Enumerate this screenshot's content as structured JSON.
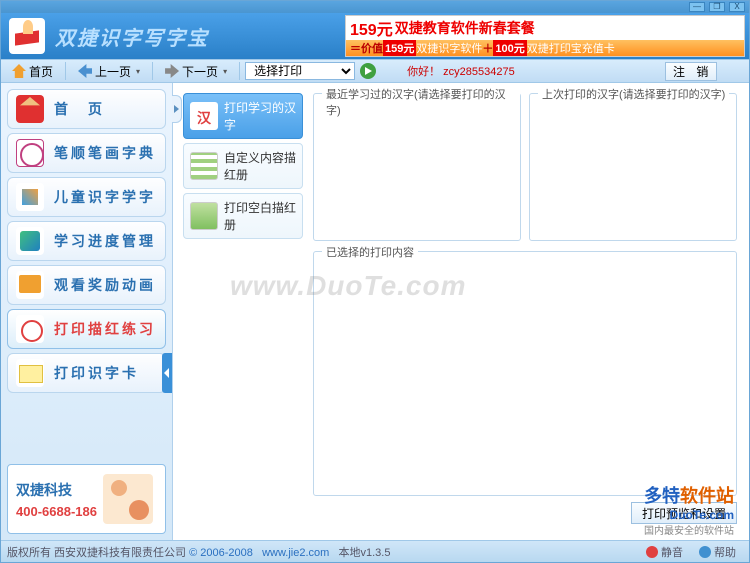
{
  "window": {
    "min": "—",
    "max": "❐",
    "close": "X"
  },
  "header": {
    "app_title": "双捷识字写字宝",
    "ad_price": "159元",
    "ad_top_text": "双捷教育软件新春套餐",
    "ad_eq": "＝价值",
    "ad_p1": "159元",
    "ad_t1": "双捷识字软件",
    "ad_plus": "＋",
    "ad_p2": "100元",
    "ad_t2": "双捷打印宝充值卡"
  },
  "toolbar": {
    "home": "首页",
    "back": "上一页",
    "forward": "下一页",
    "print_select": "选择打印",
    "hello_label": "你好！",
    "hello_value": "zcy285534275",
    "logout": "注 销"
  },
  "sidebar": {
    "items": [
      {
        "label": "首　页"
      },
      {
        "label": "笔顺笔画字典"
      },
      {
        "label": "儿童识字学字"
      },
      {
        "label": "学习进度管理"
      },
      {
        "label": "观看奖励动画"
      },
      {
        "label": "打印描红练习"
      },
      {
        "label": "打印识字卡"
      }
    ],
    "support_company": "双捷科技",
    "support_phone": "400-6688-186"
  },
  "subnav": {
    "items": [
      {
        "label": "打印学习的汉字"
      },
      {
        "label": "自定义内容描红册"
      },
      {
        "label": "打印空白描红册"
      }
    ]
  },
  "panels": {
    "recent_label": "最近学习过的汉字(请选择要打印的汉字)",
    "last_label": "上次打印的汉字(请选择要打印的汉字)",
    "selected_label": "已选择的打印内容",
    "preview_btn": "打印预览和设置"
  },
  "watermark": "www.DuoTe.com",
  "duote": {
    "zh1": "多特",
    "zh2": "软件站",
    "domain": "DuoTe.com",
    "sub": "国内最安全的软件站"
  },
  "status": {
    "copyright_prefix": "版权所有  西安双捷科技有限责任公司",
    "copyright_years": "© 2006-2008",
    "site": "www.jie2.com",
    "version": "本地v1.3.5",
    "mute": "静音",
    "help": "帮助"
  }
}
